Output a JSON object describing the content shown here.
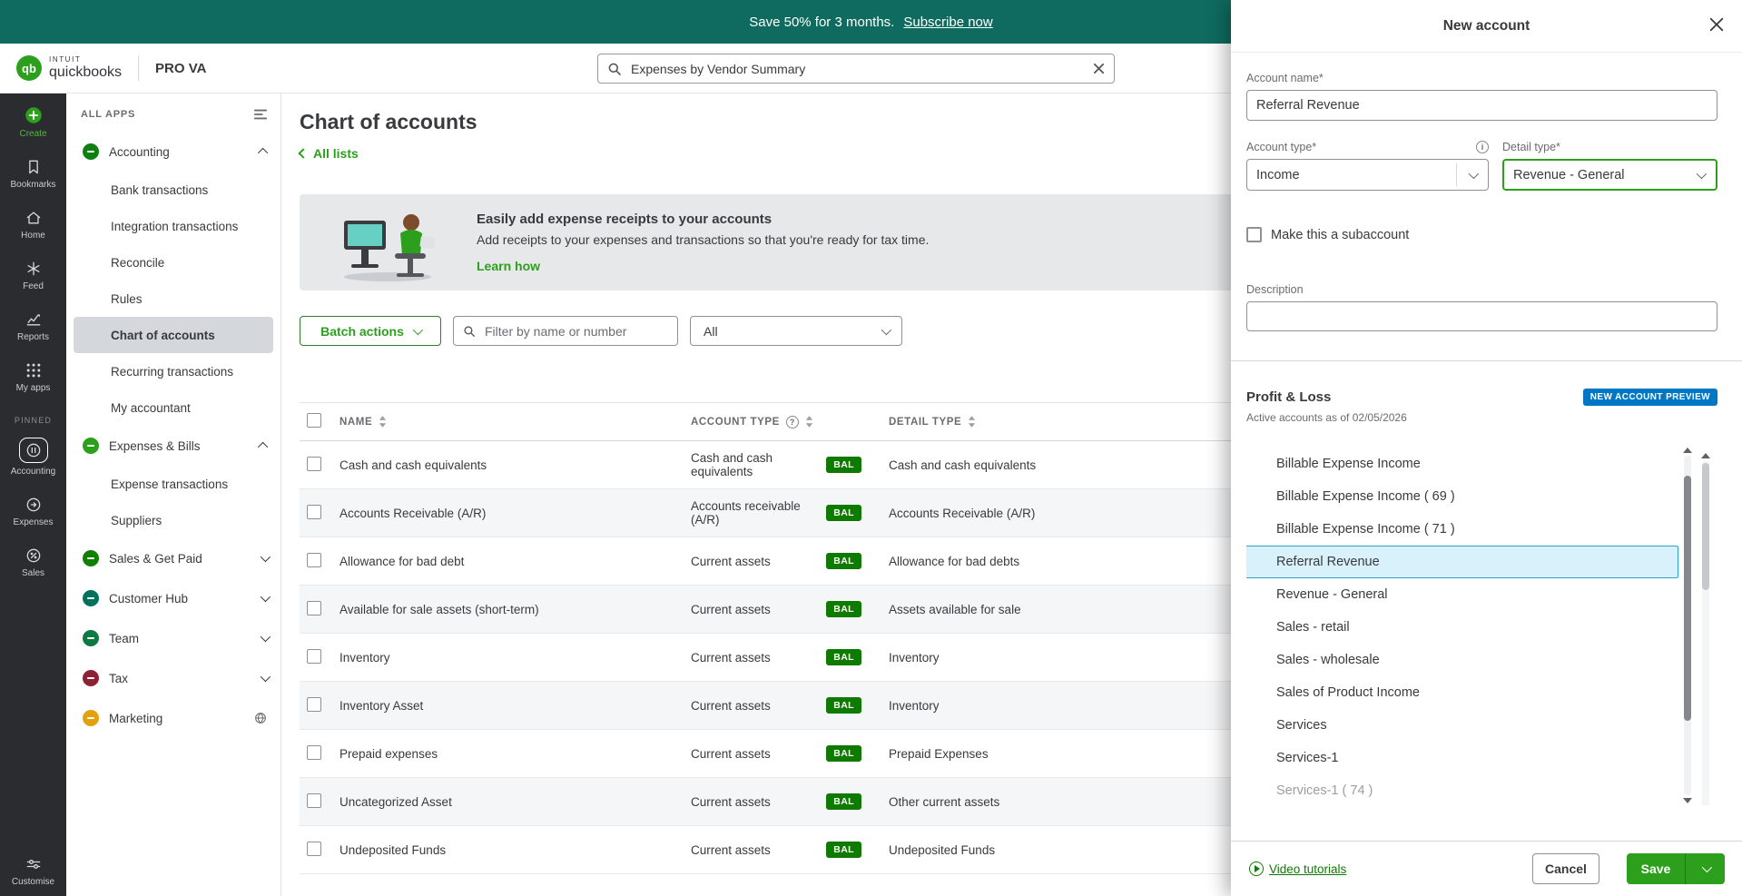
{
  "colors": {
    "brand_green": "#2ca01c",
    "banner_teal": "#0f6b5f",
    "bal_badge_green": "#0e7a00",
    "preview_badge_blue": "#0077c5",
    "selected_row_blue": "#d8f1fb",
    "focused_field_green": "#2ca01c"
  },
  "glyphs": {
    "help": "?",
    "info": "i"
  },
  "promo_banner": {
    "text": "Save 50% for 3 months.",
    "link_label": "Subscribe now"
  },
  "header": {
    "logo_monogram": "qb",
    "brand_small": "INTUIT",
    "brand": "quickbooks",
    "company": "PRO VA",
    "search_value": "Expenses by Vendor Summary"
  },
  "rail": {
    "items": [
      {
        "label": "Create"
      },
      {
        "label": "Bookmarks"
      },
      {
        "label": "Home"
      },
      {
        "label": "Feed"
      },
      {
        "label": "Reports"
      },
      {
        "label": "My apps"
      }
    ],
    "pinned_label": "PINNED",
    "pinned": [
      {
        "label": "Accounting"
      },
      {
        "label": "Expenses"
      },
      {
        "label": "Sales"
      }
    ],
    "customise_label": "Customise"
  },
  "nav": {
    "title": "ALL APPS",
    "accounting": {
      "label": "Accounting",
      "items": [
        "Bank transactions",
        "Integration transactions",
        "Reconcile",
        "Rules",
        "Chart of accounts",
        "Recurring transactions",
        "My accountant"
      ],
      "selected_item": "Chart of accounts"
    },
    "expenses": {
      "label": "Expenses & Bills",
      "items": [
        "Expense transactions",
        "Suppliers"
      ]
    },
    "collapsed": [
      {
        "label": "Sales & Get Paid"
      },
      {
        "label": "Customer Hub"
      },
      {
        "label": "Team"
      },
      {
        "label": "Tax"
      },
      {
        "label": "Marketing"
      }
    ]
  },
  "main": {
    "title": "Chart of accounts",
    "back_link": "All lists",
    "tip": {
      "title": "Easily add expense receipts to your accounts",
      "body": "Add receipts to your expenses and transactions so that you're ready for tax time.",
      "link": "Learn how"
    },
    "toolbar": {
      "batch_actions": "Batch actions",
      "filter_placeholder": "Filter by name or number",
      "type_filter": "All"
    },
    "table": {
      "columns": [
        "NAME",
        "ACCOUNT TYPE",
        "DETAIL TYPE"
      ],
      "badge": "BAL",
      "rows": [
        {
          "name": "Cash and cash equivalents",
          "type": "Cash and cash equivalents",
          "detail": "Cash and cash equivalents"
        },
        {
          "name": "Accounts Receivable (A/R)",
          "type": "Accounts receivable (A/R)",
          "detail": "Accounts Receivable (A/R)"
        },
        {
          "name": "Allowance for bad debt",
          "type": "Current assets",
          "detail": "Allowance for bad debts"
        },
        {
          "name": "Available for sale assets (short-term)",
          "type": "Current assets",
          "detail": "Assets available for sale"
        },
        {
          "name": "Inventory",
          "type": "Current assets",
          "detail": "Inventory"
        },
        {
          "name": "Inventory Asset",
          "type": "Current assets",
          "detail": "Inventory"
        },
        {
          "name": "Prepaid expenses",
          "type": "Current assets",
          "detail": "Prepaid Expenses"
        },
        {
          "name": "Uncategorized Asset",
          "type": "Current assets",
          "detail": "Other current assets"
        },
        {
          "name": "Undeposited Funds",
          "type": "Current assets",
          "detail": "Undeposited Funds"
        }
      ]
    }
  },
  "drawer": {
    "title": "New account",
    "account_name": {
      "label": "Account name*",
      "value": "Referral Revenue"
    },
    "account_type": {
      "label": "Account type*",
      "value": "Income"
    },
    "detail_type": {
      "label": "Detail type*",
      "value": "Revenue - General"
    },
    "subaccount_label": "Make this a subaccount",
    "description": {
      "label": "Description",
      "value": ""
    },
    "preview": {
      "title": "Profit & Loss",
      "badge": "NEW ACCOUNT PREVIEW",
      "subtitle": "Active accounts as of 02/05/2026",
      "items": [
        "Billable Expense Income",
        "Billable Expense Income ( 69 )",
        "Billable Expense Income ( 71 )",
        "Referral Revenue",
        "Revenue - General",
        "Sales - retail",
        "Sales - wholesale",
        "Sales of Product Income",
        "Services",
        "Services-1",
        "Services-1 ( 74 )"
      ],
      "selected_index": 3
    },
    "footer": {
      "video_link": "Video tutorials",
      "cancel": "Cancel",
      "save": "Save"
    }
  }
}
